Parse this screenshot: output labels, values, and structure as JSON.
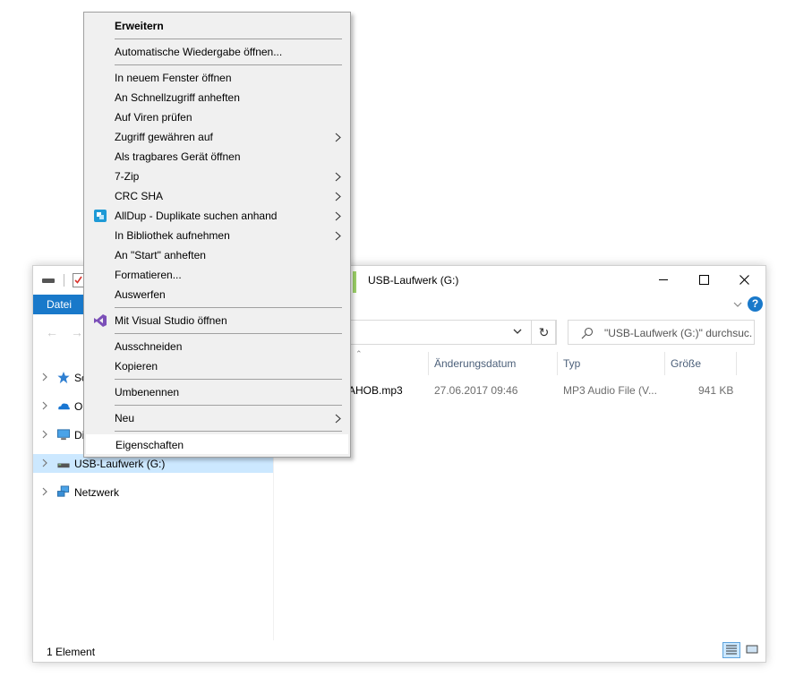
{
  "window": {
    "title": "USB-Laufwerk (G:)",
    "ribbon_tab": "Datei",
    "help": "?",
    "search_placeholder": "\"USB-Laufwerk (G:)\" durchsuc..."
  },
  "nav_pane": {
    "items": [
      {
        "label": "Sc",
        "icon": "star-icon"
      },
      {
        "label": "Or",
        "icon": "onedrive-cloud-icon"
      },
      {
        "label": "Di",
        "icon": "computer-icon"
      },
      {
        "label": "USB-Laufwerk (G:)",
        "icon": "usb-drive-icon",
        "selected": true
      },
      {
        "label": "Netzwerk",
        "icon": "network-icon"
      }
    ]
  },
  "file_list": {
    "columns": [
      "Änderungsdatum",
      "Typ",
      "Größe"
    ],
    "rows": [
      {
        "name": "AHOB.mp3",
        "date": "27.06.2017 09:46",
        "type": "MP3 Audio File (V...",
        "size": "941 KB"
      }
    ]
  },
  "status_bar": {
    "text": "1 Element"
  },
  "context_menu": {
    "items": [
      {
        "label": "Erweitern",
        "bold": true
      },
      {
        "separator": true
      },
      {
        "label": "Automatische Wiedergabe öffnen..."
      },
      {
        "separator": true
      },
      {
        "label": "In neuem Fenster öffnen"
      },
      {
        "label": "An Schnellzugriff anheften"
      },
      {
        "label": "Auf Viren prüfen"
      },
      {
        "label": "Zugriff gewähren auf",
        "submenu": true
      },
      {
        "label": "Als tragbares Gerät öffnen"
      },
      {
        "label": "7-Zip",
        "submenu": true
      },
      {
        "label": "CRC SHA",
        "submenu": true
      },
      {
        "label": "AllDup - Duplikate suchen anhand",
        "submenu": true,
        "icon": "alldup-icon"
      },
      {
        "label": "In Bibliothek aufnehmen",
        "submenu": true
      },
      {
        "label": "An \"Start\" anheften"
      },
      {
        "label": "Formatieren..."
      },
      {
        "label": "Auswerfen"
      },
      {
        "separator": true
      },
      {
        "label": "Mit Visual Studio öffnen",
        "icon": "visual-studio-icon"
      },
      {
        "separator": true
      },
      {
        "label": "Ausschneiden"
      },
      {
        "label": "Kopieren"
      },
      {
        "separator": true
      },
      {
        "label": "Umbenennen"
      },
      {
        "separator": true
      },
      {
        "label": "Neu",
        "submenu": true
      },
      {
        "separator": true
      },
      {
        "label": "Eigenschaften",
        "highlighted": true
      }
    ]
  },
  "colors": {
    "accent": "#1979ca",
    "selection": "#cce8ff",
    "menu_background": "#f0f0f0"
  }
}
